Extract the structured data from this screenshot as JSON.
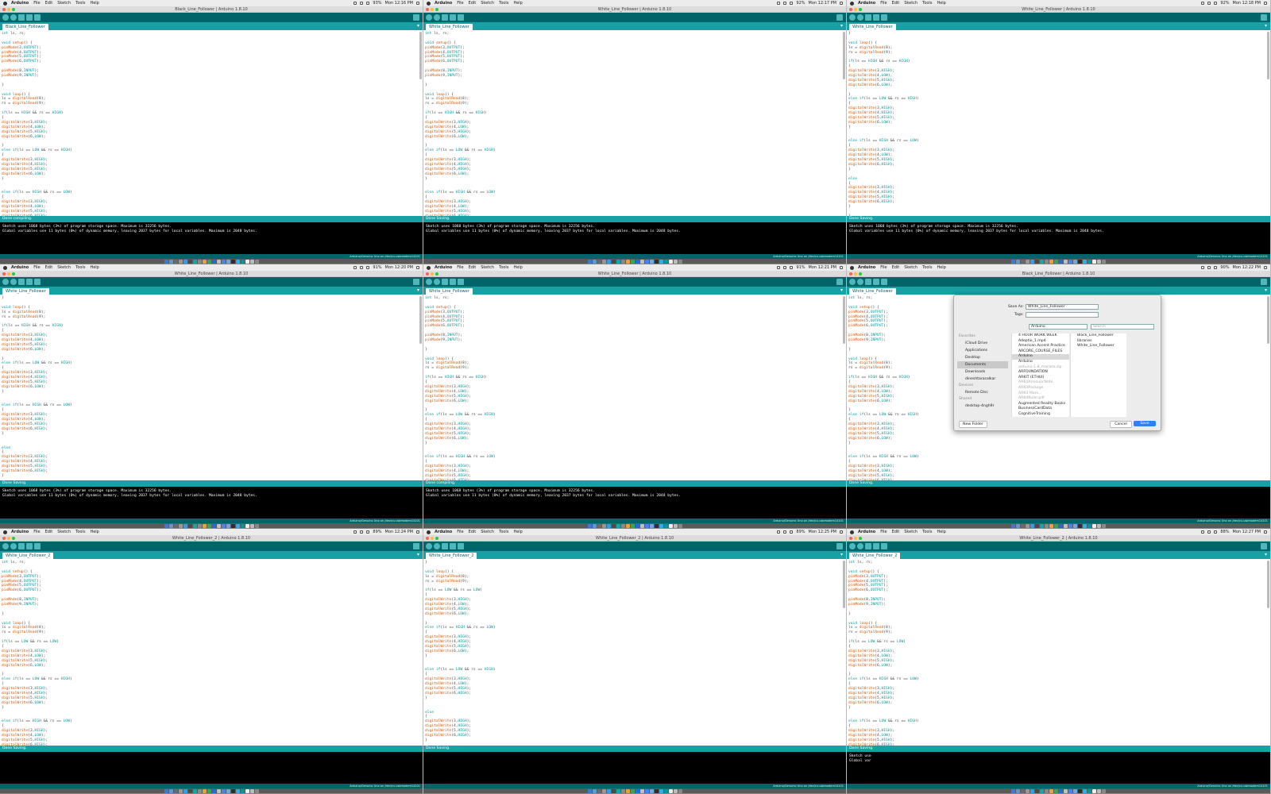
{
  "menubar": {
    "app": "Arduino",
    "items": [
      "File",
      "Edit",
      "Sketch",
      "Tools",
      "Help"
    ]
  },
  "panels": [
    {
      "clock": "Mon 12:16 PM",
      "battery": "93%",
      "title": "Black_Line_Follower | Arduino 1.8.10",
      "tab": "Black_Line_Follower",
      "status": "Done compiling.",
      "console": [
        "Sketch uses 1068 bytes (3%) of program storage space. Maximum is 32256 bytes.",
        "Global variables use 11 bytes (0%) of dynamic memory, leaving 2037 bytes for local variables. Maximum is 2048 bytes."
      ],
      "code": [
        "int ls, rs;",
        "",
        "void setup() {",
        "pinMode(3,OUTPUT);",
        "pinMode(4,OUTPUT);",
        "pinMode(5,OUTPUT);",
        "pinMode(6,OUTPUT);",
        "",
        "pinMode(8,INPUT);",
        "pinMode(9,INPUT);",
        "",
        "}",
        "",
        "void loop() {",
        "ls = digitalRead(8);",
        "rs = digitalRead(9);",
        "",
        "if(ls == HIGH && rs == HIGH)",
        "{",
        "digitalWrite(3,HIGH);",
        "digitalWrite(4,LOW);",
        "digitalWrite(5,HIGH);",
        "digitalWrite(6,LOW);",
        "",
        "}",
        "else if(ls == LOW && rs == HIGH)",
        "{",
        "digitalWrite(3,HIGH);",
        "digitalWrite(4,HIGH);",
        "digitalWrite(5,HIGH);",
        "digitalWrite(6,LOW);",
        "}",
        "",
        "",
        "else if(ls == HIGH && rs == LOW)",
        "{",
        "digitalWrite(3,HIGH);",
        "digitalWrite(4,LOW);",
        "digitalWrite(5,HIGH);",
        "digitalWrite(6,HIGH);"
      ]
    },
    {
      "clock": "Mon 12:17 PM",
      "battery": "92%",
      "title": "White_Line_Follower | Arduino 1.8.10",
      "tab": "White_Line_Follower",
      "status": "Done Saving.",
      "console": [
        "Sketch uses 1068 bytes (3%) of program storage space. Maximum is 32256 bytes.",
        "Global variables use 11 bytes (0%) of dynamic memory, leaving 2037 bytes for local variables. Maximum is 2048 bytes."
      ],
      "code": [
        "int ls, rs;",
        "",
        "void setup() {",
        "pinMode(3,OUTPUT);",
        "pinMode(4,OUTPUT);",
        "pinMode(5,OUTPUT);",
        "pinMode(6,OUTPUT);",
        "",
        "pinMode(8,INPUT);",
        "pinMode(9,INPUT);",
        "",
        "}",
        "",
        "void loop() {",
        "ls = digitalRead(8);",
        "rs = digitalRead(9);",
        "",
        "if(ls == HIGH && rs == HIGH)",
        "{",
        "digitalWrite(3,HIGH);",
        "digitalWrite(4,LOW);",
        "digitalWrite(5,HIGH);",
        "digitalWrite(6,LOW);",
        "",
        "}",
        "else if(ls == LOW && rs == HIGH)",
        "{",
        "digitalWrite(3,HIGH);",
        "digitalWrite(4,HIGH);",
        "digitalWrite(5,HIGH);",
        "digitalWrite(6,LOW);",
        "}",
        "",
        "",
        "else if(ls == HIGH && rs == LOW)",
        "{",
        "digitalWrite(3,HIGH);",
        "digitalWrite(4,LOW);",
        "digitalWrite(5,HIGH);",
        "digitalWrite(6,HIGH);"
      ]
    },
    {
      "clock": "Mon 12:18 PM",
      "battery": "92%",
      "title": "White_Line_Follower | Arduino 1.8.10",
      "tab": "White_Line_Follower",
      "status": "Done Saving.",
      "console": [
        "Sketch uses 1068 bytes (3%) of program storage space. Maximum is 32256 bytes.",
        "Global variables use 11 bytes (0%) of dynamic memory, leaving 2037 bytes for local variables. Maximum is 2048 bytes."
      ],
      "code": [
        "}",
        "",
        "void loop() {",
        "ls = digitalRead(8);",
        "rs = digitalRead(9);",
        "",
        "if(ls == HIGH && rs == HIGH)",
        "{",
        "digitalWrite(3,HIGH);",
        "digitalWrite(4,LOW);",
        "digitalWrite(5,HIGH);",
        "digitalWrite(6,LOW);",
        "",
        "}",
        "else if(ls == LOW && rs == HIGH)",
        "{",
        "digitalWrite(3,HIGH);",
        "digitalWrite(4,HIGH);",
        "digitalWrite(5,HIGH);",
        "digitalWrite(6,LOW);",
        "}",
        "",
        "",
        "else if(ls == HIGH && rs == LOW)",
        "{",
        "digitalWrite(3,HIGH);",
        "digitalWrite(4,LOW);",
        "digitalWrite(5,HIGH);",
        "digitalWrite(6,HIGH);",
        "}",
        "",
        "else",
        "{",
        "digitalWrite(3,HIGH);",
        "digitalWrite(4,HIGH);",
        "digitalWrite(5,HIGH);",
        "digitalWrite(6,HIGH);",
        "}",
        "",
        "}"
      ]
    },
    {
      "clock": "Mon 12:20 PM",
      "battery": "91%",
      "title": "White_Line_Follower | Arduino 1.8.10",
      "tab": "White_Line_Follower",
      "status": "Done Saving.",
      "console": [
        "Sketch uses 1068 bytes (3%) of program storage space. Maximum is 32256 bytes.",
        "Global variables use 11 bytes (0%) of dynamic memory, leaving 2037 bytes for local variables. Maximum is 2048 bytes."
      ],
      "code": [
        "}",
        "",
        "void loop() {",
        "ls = digitalRead(8);",
        "rs = digitalRead(9);",
        "",
        "if(ls == HIGH && rs == HIGH)",
        "{",
        "digitalWrite(3,HIGH);",
        "digitalWrite(4,LOW);",
        "digitalWrite(5,HIGH);",
        "digitalWrite(6,LOW);",
        "",
        "}",
        "else if(ls == LOW && rs == HIGH)",
        "{",
        "digitalWrite(3,HIGH);",
        "digitalWrite(4,HIGH);",
        "digitalWrite(5,HIGH);",
        "digitalWrite(6,LOW);",
        "}",
        "",
        "",
        "else if(ls == HIGH && rs == LOW)",
        "{",
        "digitalWrite(3,HIGH);",
        "digitalWrite(4,LOW);",
        "digitalWrite(5,HIGH);",
        "digitalWrite(6,HIGH);",
        "}",
        "",
        "",
        "else",
        "{",
        "digitalWrite(3,HIGH);",
        "digitalWrite(4,HIGH);",
        "digitalWrite(5,HIGH);",
        "digitalWrite(6,HIGH);",
        "}",
        "",
        "}"
      ]
    },
    {
      "clock": "Mon 12:21 PM",
      "battery": "91%",
      "title": "White_Line_Follower | Arduino 1.8.10",
      "tab": "White_Line_Follower",
      "status": "Done compiling.",
      "console": [
        "Sketch uses 1068 bytes (3%) of program storage space. Maximum is 32256 bytes.",
        "Global variables use 11 bytes (0%) of dynamic memory, leaving 2037 bytes for local variables. Maximum is 2048 bytes."
      ],
      "code": [
        "int ls, rs;",
        "",
        "void setup() {",
        "pinMode(3,OUTPUT);",
        "pinMode(4,OUTPUT);",
        "pinMode(5,OUTPUT);",
        "pinMode(6,OUTPUT);",
        "",
        "pinMode(8,INPUT);",
        "pinMode(9,INPUT);",
        "",
        "}",
        "",
        "void loop() {",
        "ls = digitalRead(8);",
        "rs = digitalRead(9);",
        "",
        "if(ls == HIGH && rs == HIGH)",
        "{",
        "digitalWrite(3,HIGH);",
        "digitalWrite(4,LOW);",
        "digitalWrite(5,HIGH);",
        "digitalWrite(6,LOW);",
        "",
        "}",
        "else if(ls == LOW && rs == HIGH)",
        "{",
        "digitalWrite(3,HIGH);",
        "digitalWrite(4,HIGH);",
        "digitalWrite(5,HIGH);",
        "digitalWrite(6,LOW);",
        "}",
        "",
        "",
        "else if(ls == HIGH && rs == LOW)",
        "{",
        "digitalWrite(3,HIGH);",
        "digitalWrite(4,LOW);",
        "digitalWrite(5,HIGH);",
        "digitalWrite(6,HIGH);"
      ]
    },
    {
      "clock": "Mon 12:22 PM",
      "battery": "90%",
      "title": "Black_Line_Follower | Arduino 1.8.10",
      "tab": "White_Line_Follower",
      "status": "Done Saving.",
      "console": [],
      "code": [
        "int ls, rs;",
        "",
        "void setup() {",
        "pinMode(3,OUTPUT);",
        "pinMode(4,OUTPUT);",
        "pinMode(5,OUTPUT);",
        "pinMode(6,OUTPUT);",
        "",
        "pinMode(8,INPUT);",
        "pinMode(9,INPUT);",
        "",
        "}",
        "",
        "void loop() {",
        "ls = digitalRead(8);",
        "rs = digitalRead(9);",
        "",
        "if(ls == HIGH && rs == HIGH)",
        "{",
        "digitalWrite(3,HIGH);",
        "digitalWrite(4,LOW);",
        "digitalWrite(5,HIGH);",
        "digitalWrite(6,LOW);",
        "",
        "}",
        "else if(ls == LOW && rs == HIGH)",
        "{",
        "digitalWrite(3,HIGH);",
        "digitalWrite(4,HIGH);",
        "digitalWrite(5,HIGH);",
        "digitalWrite(6,LOW);",
        "}",
        "",
        "",
        "else if(ls == HIGH && rs == LOW)",
        "{",
        "digitalWrite(3,HIGH);",
        "digitalWrite(4,LOW);",
        "digitalWrite(5,HIGH);",
        "digitalWrite(6,HIGH);"
      ],
      "dialog": {
        "save_as_label": "Save As:",
        "save_as_value": "White_Line_Follower",
        "tags_label": "Tags:",
        "location": "Arduino",
        "search_placeholder": "Search",
        "favorites_header": "Favorites",
        "favorites": [
          "iCloud Drive",
          "Applications",
          "Desktop",
          "Documents",
          "Downloads",
          "dineshtarasalkar"
        ],
        "devices_header": "Devices",
        "devices": [
          "Remote Disc"
        ],
        "shared_header": "Shared",
        "shared": [
          "desktop-4ngh9r"
        ],
        "column1": [
          "4 HOUR WORK WEEK",
          "Adeptio_1.mp4",
          "American Accent Practice",
          "ARCORE_COURSE_FILES",
          "Arduino",
          "Arduino",
          "arduino-1.8_macosx.zip",
          "ARFOUNDATION",
          "ARKIT (ETHUI)",
          "ARKitAnnouncNote",
          "ARKitPackage",
          "ARKit Mars...",
          "ARKitRuler.pdf",
          "Augmented Reality Books",
          "BusinessCardData",
          "CognitiveTraining"
        ],
        "column2": [
          "Black_Line_Follower",
          "libraries",
          "White_Line_Follower"
        ],
        "new_folder": "New Folder",
        "cancel": "Cancel",
        "save": "Save"
      }
    },
    {
      "clock": "Mon 12:24 PM",
      "battery": "89%",
      "title": "White_Line_Follower_2 | Arduino 1.8.10",
      "tab": "White_Line_Follower_2",
      "status": "Done Saving.",
      "console": [],
      "code": [
        "int ls, rs;",
        "",
        "void setup() {",
        "pinMode(3,OUTPUT);",
        "pinMode(4,OUTPUT);",
        "pinMode(5,OUTPUT);",
        "pinMode(6,OUTPUT);",
        "",
        "pinMode(8,INPUT);",
        "pinMode(9,INPUT);",
        "",
        "}",
        "",
        "void loop() {",
        "ls = digitalRead(8);",
        "rs = digitalRead(9);",
        "",
        "if(ls == LOW && rs == LOW)",
        "{",
        "digitalWrite(3,HIGH);",
        "digitalWrite(4,LOW);",
        "digitalWrite(5,HIGH);",
        "digitalWrite(6,LOW);",
        "",
        "}",
        "else if(ls == LOW && rs == HIGH)",
        "{",
        "digitalWrite(3,HIGH);",
        "digitalWrite(4,HIGH);",
        "digitalWrite(5,HIGH);",
        "digitalWrite(6,LOW);",
        "}",
        "",
        "",
        "else if(ls == HIGH && rs == LOW)",
        "{",
        "digitalWrite(3,HIGH);",
        "digitalWrite(4,LOW);",
        "digitalWrite(5,HIGH);",
        "digitalWrite(6,HIGH);"
      ]
    },
    {
      "clock": "Mon 12:25 PM",
      "battery": "89%",
      "title": "White_Line_Follower_2 | Arduino 1.8.10",
      "tab": "White_Line_Follower_2",
      "status": "Done Saving.",
      "console": [],
      "code": [
        "}",
        "",
        "void loop() {",
        "ls = digitalRead(8);",
        "rs = digitalRead(9);",
        "",
        "if(ls == LOW && rs == LOW)",
        "{",
        "digitalWrite(3,HIGH);",
        "digitalWrite(4,LOW);",
        "digitalWrite(5,HIGH);",
        "digitalWrite(6,LOW);",
        "",
        "}",
        "else if(ls == HIGH && rs == LOW)",
        "{",
        "digitalWrite(3,HIGH);",
        "digitalWrite(4,HIGH);",
        "digitalWrite(5,HIGH);",
        "digitalWrite(6,LOW);",
        "}",
        "",
        "",
        "else if(ls == LOW && rs == HIGH)",
        "{",
        "digitalWrite(3,HIGH);",
        "digitalWrite(4,LOW);",
        "digitalWrite(5,HIGH);",
        "digitalWrite(6,HIGH);",
        "}",
        "",
        "",
        "else",
        "{",
        "digitalWrite(3,HIGH);",
        "digitalWrite(4,HIGH);",
        "digitalWrite(5,HIGH);",
        "digitalWrite(6,HIGH);",
        "}",
        "",
        "}"
      ]
    },
    {
      "clock": "Mon 12:27 PM",
      "battery": "88%",
      "title": "White_Line_Follower_2 | Arduino 1.8.10",
      "tab": "White_Line_Follower_2",
      "status": "Done Saving.",
      "console": [
        "Sketch use",
        "Global var"
      ],
      "code": [
        "int ls, rs;",
        "",
        "void setup() {",
        "pinMode(3,OUTPUT);",
        "pinMode(4,OUTPUT);",
        "pinMode(5,OUTPUT);",
        "pinMode(6,OUTPUT);",
        "",
        "pinMode(8,INPUT);",
        "pinMode(9,INPUT);",
        "",
        "}",
        "",
        "void loop() {",
        "ls = digitalRead(8);",
        "rs = digitalRead(9);",
        "",
        "if(ls == LOW && rs == LOW)",
        "{",
        "digitalWrite(3,HIGH);",
        "digitalWrite(4,LOW);",
        "digitalWrite(5,HIGH);",
        "digitalWrite(6,LOW);",
        "",
        "}",
        "else if(ls == HIGH && rs == LOW)",
        "{",
        "digitalWrite(3,HIGH);",
        "digitalWrite(4,HIGH);",
        "digitalWrite(5,HIGH);",
        "digitalWrite(6,LOW);",
        "}",
        "",
        "",
        "else if(ls == LOW && rs == HIGH)",
        "{",
        "digitalWrite(3,HIGH);",
        "digitalWrite(4,LOW);",
        "digitalWrite(5,HIGH);",
        "digitalWrite(6,HIGH);"
      ]
    }
  ],
  "footer": {
    "board": "Arduino/Genuino Uno on /dev/cu.usbmodem14101"
  },
  "colors": {
    "toolbar": "#006468",
    "tabbar": "#17a1a5",
    "button": "#4db7bb",
    "console": "#000000"
  },
  "dock_icons": [
    "#3a7bd5",
    "#5b9bd5",
    "#6a6a6a",
    "#999999",
    "#2aa0f0",
    "#4a4a4a",
    "#0fa9a9",
    "#8a8a8a",
    "#e8a33d",
    "#34a853",
    "#1b6fd6",
    "#c0c0c0",
    "#4285f4",
    "#6fa9e0",
    "#2f2f2f",
    "#27b3e8",
    "#00979c",
    "#eeeeee",
    "#bbbbbb",
    "#888888"
  ]
}
